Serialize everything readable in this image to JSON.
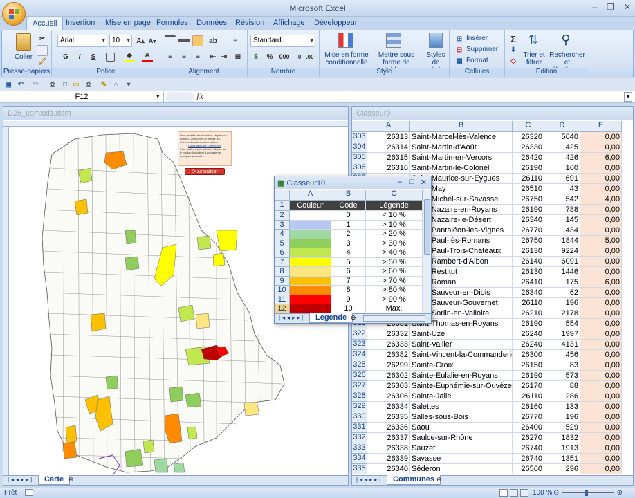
{
  "app": {
    "title": "Microsoft Excel"
  },
  "window_controls": {
    "minimize": "–",
    "restore": "❐",
    "close": "✕"
  },
  "tabs": [
    "Accueil",
    "Insertion",
    "Mise en page",
    "Formules",
    "Données",
    "Révision",
    "Affichage",
    "Développeur"
  ],
  "ribbon": {
    "clipboard": {
      "caption": "Presse-papiers",
      "paste": "Coller"
    },
    "font": {
      "caption": "Police",
      "name": "Arial",
      "size": "10",
      "bold": "G",
      "italic": "I",
      "underline": "S"
    },
    "alignment": {
      "caption": "Alignment"
    },
    "number": {
      "caption": "Nombre",
      "format": "Standard",
      "percent": "%",
      "thousands": "000"
    },
    "styles": {
      "caption": "Style",
      "conditional": "Mise en forme conditionnelle",
      "table": "Mettre sous forme de tableau",
      "cell_styles": "Styles de cellules"
    },
    "cells": {
      "caption": "Cellules",
      "insert": "Insérer",
      "delete": "Supprimer",
      "format": "Format"
    },
    "editing": {
      "caption": "Edition",
      "sort": "Trier et filtrer",
      "find": "Rechercher et sélectionner",
      "sum": "Σ"
    }
  },
  "formula_bar": {
    "name_box": "F12",
    "fx": "fx",
    "value": ""
  },
  "left_workbook": {
    "title": "D26_comxxls.xlsm",
    "sheet_tab": "Carte",
    "button_label": "actualiser",
    "note_lines": [
      "Pour modifier les données, cliquez sur",
      "l'onglet Communes et mettez les",
      "entrées dans la colonne Valeur.",
      "Ouvrir la feuille Communes",
      "",
      "Pour mettre à jour la carte, cliquez sur",
      "le bouton Actualiser. Les patterns",
      "quelques secondes"
    ]
  },
  "right_workbook": {
    "title": "Classeur9",
    "sheet_tab": "Communes",
    "columns": [
      "A",
      "B",
      "C",
      "D",
      "E"
    ],
    "rows": [
      [
        "303",
        "26313",
        "Saint-Marcel-lès-Valence",
        "26320",
        "5640",
        "0,00"
      ],
      [
        "304",
        "26314",
        "Saint-Martin-d'Août",
        "26330",
        "425",
        "0,00"
      ],
      [
        "305",
        "26315",
        "Saint-Martin-en-Vercors",
        "26420",
        "426",
        "6,00"
      ],
      [
        "306",
        "26316",
        "Saint-Martin-le-Colonel",
        "26190",
        "160",
        "0,00"
      ],
      [
        "307",
        "",
        "Saint-Maurice-sur-Eygues",
        "26110",
        "691",
        "0,00"
      ],
      [
        "308",
        "",
        "Saint-May",
        "26510",
        "43",
        "0,00"
      ],
      [
        "309",
        "",
        "Saint-Michel-sur-Savasse",
        "26750",
        "542",
        "4,00"
      ],
      [
        "310",
        "",
        "Saint-Nazaire-en-Royans",
        "26190",
        "788",
        "0,00"
      ],
      [
        "311",
        "",
        "Saint-Nazaire-le-Désert",
        "26340",
        "145",
        "0,00"
      ],
      [
        "312",
        "",
        "Saint-Pantaléon-les-Vignes",
        "26770",
        "434",
        "0,00"
      ],
      [
        "313",
        "",
        "Saint-Paul-lès-Romans",
        "26750",
        "1844",
        "5,00"
      ],
      [
        "314",
        "",
        "Saint-Paul-Trois-Châteaux",
        "26130",
        "9224",
        "0,00"
      ],
      [
        "315",
        "",
        "Saint-Rambert-d'Albon",
        "26140",
        "6091",
        "0,00"
      ],
      [
        "316",
        "",
        "Saint-Restitut",
        "26130",
        "1446",
        "0,00"
      ],
      [
        "317",
        "",
        "Saint-Roman",
        "26410",
        "175",
        "6,00"
      ],
      [
        "318",
        "",
        "Saint-Sauveur-en-Diois",
        "26340",
        "62",
        "0,00"
      ],
      [
        "319",
        "",
        "Saint-Sauveur-Gouvernet",
        "26110",
        "196",
        "0,00"
      ],
      [
        "320",
        "",
        "Saint-Sorlin-en-Valloire",
        "26210",
        "2178",
        "0,00"
      ],
      [
        "321",
        "26331",
        "Saint-Thomas-en-Royans",
        "26190",
        "554",
        "0,00"
      ],
      [
        "322",
        "26332",
        "Saint-Uze",
        "26240",
        "1997",
        "0,00"
      ],
      [
        "323",
        "26333",
        "Saint-Vallier",
        "26240",
        "4131",
        "0,00"
      ],
      [
        "324",
        "26382",
        "Saint-Vincent-la-Commanderie",
        "26300",
        "456",
        "0,00"
      ],
      [
        "325",
        "26299",
        "Sainte-Croix",
        "26150",
        "83",
        "0,00"
      ],
      [
        "326",
        "26302",
        "Sainte-Eulalie-en-Royans",
        "26190",
        "573",
        "0,00"
      ],
      [
        "327",
        "26303",
        "Sainte-Euphémie-sur-Ouvèze",
        "26170",
        "88",
        "0,00"
      ],
      [
        "328",
        "26306",
        "Sainte-Jalle",
        "26110",
        "286",
        "0,00"
      ],
      [
        "329",
        "26334",
        "Salettes",
        "26160",
        "133",
        "0,00"
      ],
      [
        "330",
        "26335",
        "Salles-sous-Bois",
        "26770",
        "196",
        "0,00"
      ],
      [
        "331",
        "26336",
        "Saou",
        "26400",
        "529",
        "0,00"
      ],
      [
        "332",
        "26337",
        "Saulce-sur-Rhône",
        "26270",
        "1832",
        "0,00"
      ],
      [
        "333",
        "26338",
        "Sauzet",
        "26740",
        "1913",
        "0,00"
      ],
      [
        "334",
        "26339",
        "Savasse",
        "26740",
        "1351",
        "0,00"
      ],
      [
        "335",
        "26340",
        "Séderon",
        "26560",
        "296",
        "0,00"
      ]
    ]
  },
  "legend_workbook": {
    "title": "Classeur10",
    "sheet_tab": "Legende",
    "columns": [
      "A",
      "B",
      "C"
    ],
    "header": [
      "Couleur",
      "Code",
      "Légende"
    ],
    "rows": [
      {
        "num": "2",
        "code": "0",
        "label": "< 10 %",
        "color": "#ffffff"
      },
      {
        "num": "3",
        "code": "1",
        "label": "> 10 %",
        "color": "#b7c9f2"
      },
      {
        "num": "4",
        "code": "2",
        "label": "> 20 %",
        "color": "#9fd9a2"
      },
      {
        "num": "5",
        "code": "3",
        "label": "> 30 %",
        "color": "#8fce5c"
      },
      {
        "num": "6",
        "code": "4",
        "label": "> 40 %",
        "color": "#c2e84f"
      },
      {
        "num": "7",
        "code": "5",
        "label": "> 50 %",
        "color": "#ffff00"
      },
      {
        "num": "8",
        "code": "6",
        "label": "> 60 %",
        "color": "#ffe680"
      },
      {
        "num": "9",
        "code": "7",
        "label": "> 70 %",
        "color": "#ffc000"
      },
      {
        "num": "10",
        "code": "8",
        "label": "> 80 %",
        "color": "#ff8c00"
      },
      {
        "num": "11",
        "code": "9",
        "label": "> 90 %",
        "color": "#ff0000"
      },
      {
        "num": "12",
        "code": "10",
        "label": "Max.",
        "color": "#c00000"
      }
    ]
  },
  "status": {
    "ready": "Prêt",
    "zoom": "100 %"
  }
}
